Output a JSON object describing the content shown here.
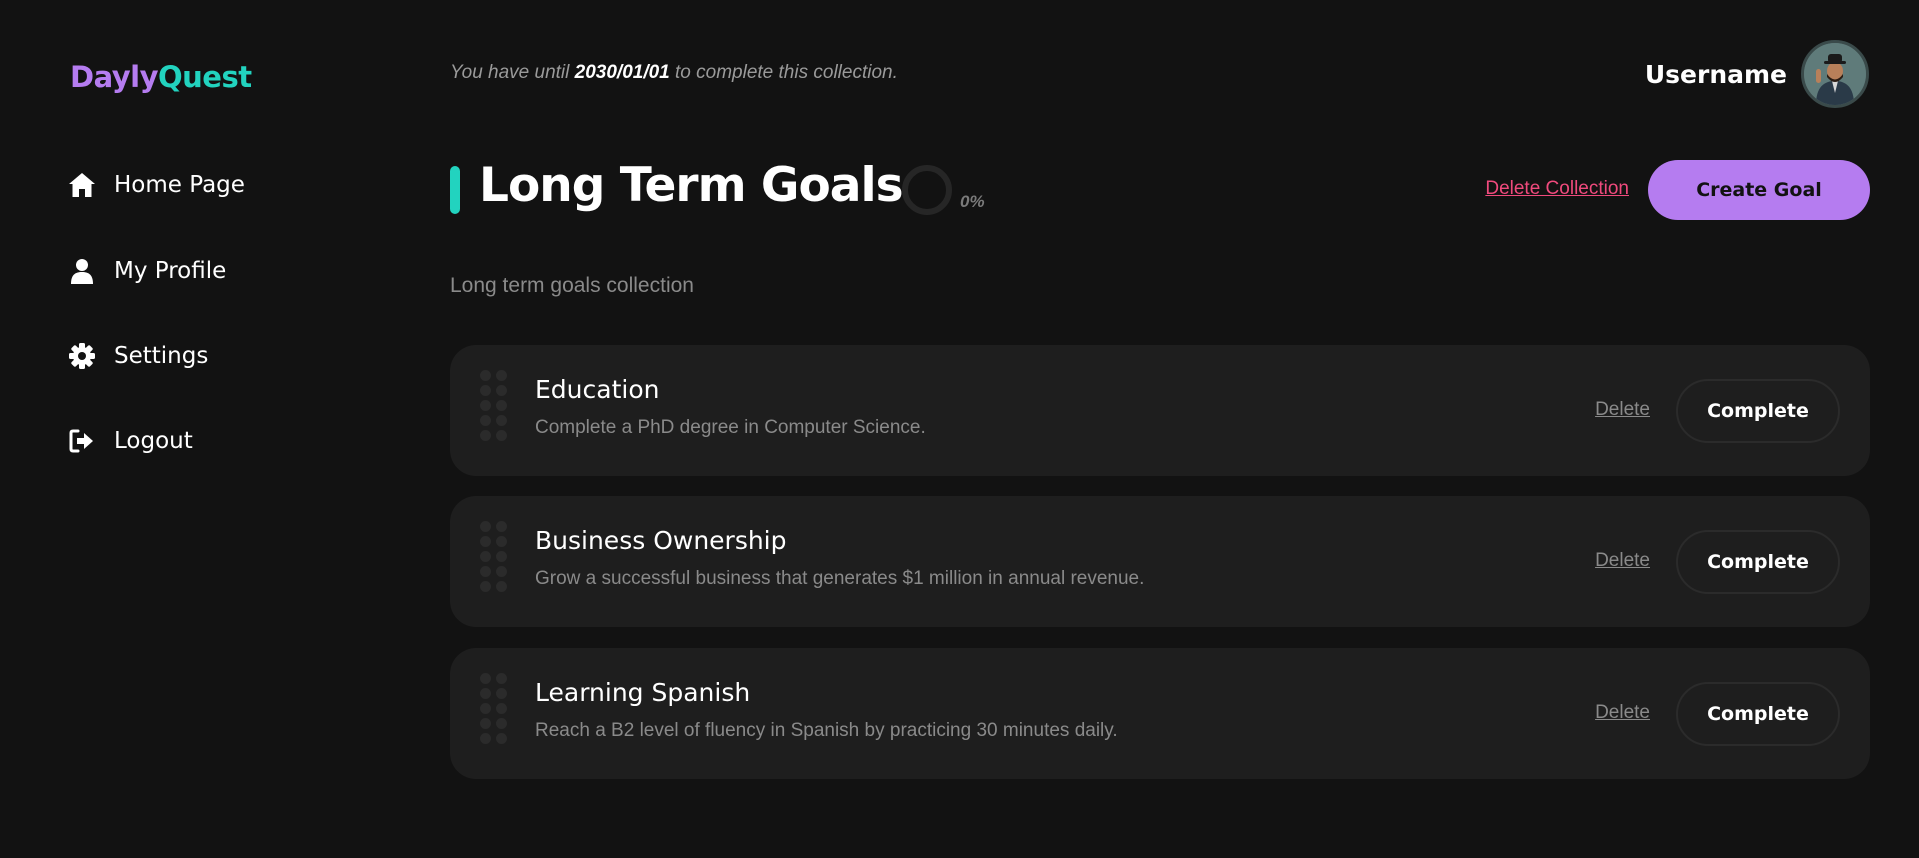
{
  "brand": {
    "part1": "Dayly",
    "part2": "Quest"
  },
  "sidebar": {
    "items": [
      {
        "label": "Home Page",
        "icon": "home-icon"
      },
      {
        "label": "My Profile",
        "icon": "user-icon"
      },
      {
        "label": "Settings",
        "icon": "gear-icon"
      },
      {
        "label": "Logout",
        "icon": "logout-icon"
      }
    ]
  },
  "header": {
    "deadline_prefix": "You have until",
    "deadline_date": "2030/01/01",
    "deadline_suffix": "to complete this collection.",
    "username": "Username"
  },
  "collection": {
    "title": "Long Term Goals",
    "progress_text": "0%",
    "progress": 0,
    "description": "Long term goals collection",
    "delete_label": "Delete Collection",
    "create_label": "Create Goal"
  },
  "goals": [
    {
      "title": "Education",
      "description": "Complete a PhD degree in Computer Science.",
      "delete_label": "Delete",
      "complete_label": "Complete"
    },
    {
      "title": "Business Ownership",
      "description": "Grow a successful business that generates $1 million in annual revenue.",
      "delete_label": "Delete",
      "complete_label": "Complete"
    },
    {
      "title": "Learning Spanish",
      "description": "Reach a B2 level of fluency in Spanish by practicing 30 minutes daily.",
      "delete_label": "Delete",
      "complete_label": "Complete"
    }
  ],
  "colors": {
    "background": "#121212",
    "card": "#1e1e1e",
    "accent_purple": "#b57cf0",
    "accent_teal": "#22d3bf",
    "danger": "#f04a7d"
  }
}
